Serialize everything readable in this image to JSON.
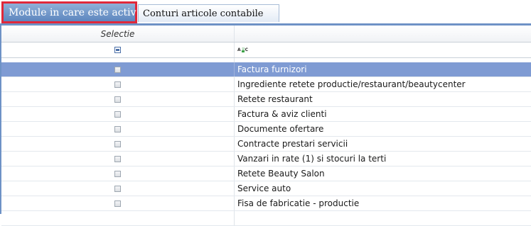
{
  "tabs": [
    {
      "label": "Module in care este activ"
    },
    {
      "label": "Conturi articole contabile"
    }
  ],
  "grid": {
    "header_selectie": "Selectie",
    "filter_icon_text": "A C",
    "rows": [
      "Factura furnizori",
      "Ingrediente retete productie/restaurant/beautycenter",
      "Retete restaurant",
      "Factura & aviz clienti",
      "Documente ofertare",
      "Contracte prestari servicii",
      "Vanzari in rate (1) si stocuri la terti",
      "Retete Beauty Salon",
      "Service auto",
      "Fisa de fabricatie - productie"
    ]
  },
  "colors": {
    "selected_row": "#7f9bd3",
    "tab_active_border": "#e0283a",
    "tab_active_bg": "#5d86bf"
  }
}
